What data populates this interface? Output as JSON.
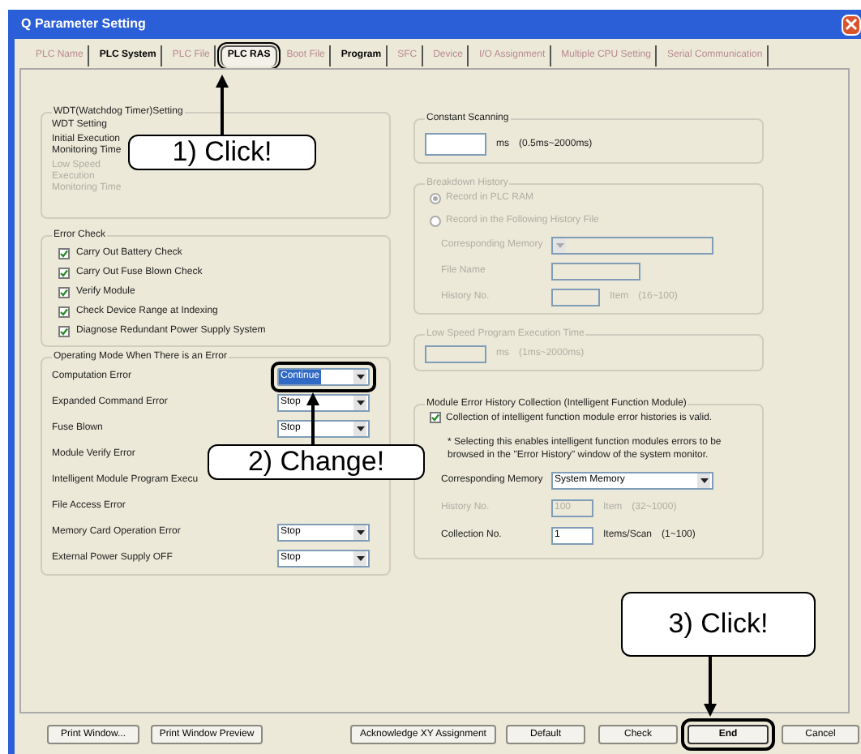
{
  "window": {
    "title": "Q Parameter Setting"
  },
  "tabs": [
    {
      "label": "PLC Name",
      "selected": false,
      "emphasized": false
    },
    {
      "label": "PLC System",
      "selected": false,
      "emphasized": true
    },
    {
      "label": "PLC File",
      "selected": false,
      "emphasized": false
    },
    {
      "label": "PLC RAS",
      "selected": true,
      "emphasized": true
    },
    {
      "label": "Boot File",
      "selected": false,
      "emphasized": false
    },
    {
      "label": "Program",
      "selected": false,
      "emphasized": true
    },
    {
      "label": "SFC",
      "selected": false,
      "emphasized": false
    },
    {
      "label": "Device",
      "selected": false,
      "emphasized": false
    },
    {
      "label": "I/O Assignment",
      "selected": false,
      "emphasized": false
    },
    {
      "label": "Multiple CPU Setting",
      "selected": false,
      "emphasized": false
    },
    {
      "label": "Serial Communication",
      "selected": false,
      "emphasized": false
    }
  ],
  "wdt": {
    "title": "WDT(Watchdog Timer)Setting",
    "rows": [
      {
        "label": "WDT Setting",
        "disabled": false
      },
      {
        "label": "Initial Execution Monitoring Time",
        "disabled": false
      },
      {
        "label": "Low Speed Execution Monitoring Time",
        "disabled": true
      }
    ]
  },
  "error_check": {
    "title": "Error Check",
    "items": [
      {
        "label": "Carry Out Battery Check",
        "checked": true
      },
      {
        "label": "Carry Out Fuse Blown Check",
        "checked": true
      },
      {
        "label": "Verify Module",
        "checked": true
      },
      {
        "label": "Check Device Range at Indexing",
        "checked": true
      },
      {
        "label": "Diagnose Redundant Power Supply System",
        "checked": true
      }
    ]
  },
  "operating_mode": {
    "title": "Operating Mode When There is an Error",
    "rows": [
      {
        "label": "Computation Error",
        "value": "Continue",
        "highlighted": true
      },
      {
        "label": "Expanded Command Error",
        "value": "Stop",
        "highlighted": false
      },
      {
        "label": "Fuse Blown",
        "value": "Stop",
        "highlighted": false
      },
      {
        "label": "Module Verify Error"
      },
      {
        "label": "Intelligent Module Program Execu"
      },
      {
        "label": "File Access Error"
      },
      {
        "label": "Memory Card Operation Error",
        "value": "Stop",
        "highlighted": false
      },
      {
        "label": "External Power Supply OFF",
        "value": "Stop",
        "highlighted": false
      }
    ]
  },
  "constant_scanning": {
    "title": "Constant Scanning",
    "unit": "ms",
    "range": "(0.5ms~2000ms)",
    "disabled": false
  },
  "breakdown_history": {
    "title": "Breakdown History",
    "disabled": true,
    "radios": [
      {
        "label": "Record in PLC RAM",
        "selected": true
      },
      {
        "label": "Record in the Following History File",
        "selected": false
      }
    ],
    "memory_label": "Corresponding Memory",
    "file_label": "File Name",
    "history_label": "History No.",
    "history_unit": "Item",
    "history_range": "(16~100)"
  },
  "low_speed": {
    "title": "Low Speed Program Execution Time",
    "unit": "ms",
    "range": "(1ms~2000ms)",
    "disabled": true
  },
  "module_error": {
    "title": "Module Error History Collection (Intelligent Function Module)",
    "checkbox": {
      "label": "Collection of intelligent function module error histories is valid.",
      "checked": true
    },
    "note": "* Selecting this enables intelligent function modules errors to be browsed in the \"Error History\" window of the system monitor.",
    "memory_label": "Corresponding Memory",
    "memory_value": "System Memory",
    "history_label": "History No.",
    "history_value": "100",
    "history_unit": "Item",
    "history_range": "(32~1000)",
    "collection_label": "Collection No.",
    "collection_value": "1",
    "collection_unit": "Items/Scan",
    "collection_range": "(1~100)"
  },
  "buttons": [
    {
      "label": "Print Window...",
      "highlighted": false
    },
    {
      "label": "Print Window Preview",
      "highlighted": false
    },
    {
      "label": "Acknowledge XY Assignment",
      "highlighted": false
    },
    {
      "label": "Default",
      "highlighted": false
    },
    {
      "label": "Check",
      "highlighted": false
    },
    {
      "label": "End",
      "highlighted": true
    },
    {
      "label": "Cancel",
      "highlighted": false
    }
  ],
  "callouts": [
    {
      "text": "1) Click!"
    },
    {
      "text": "2) Change!"
    },
    {
      "text": "3) Click!"
    }
  ]
}
